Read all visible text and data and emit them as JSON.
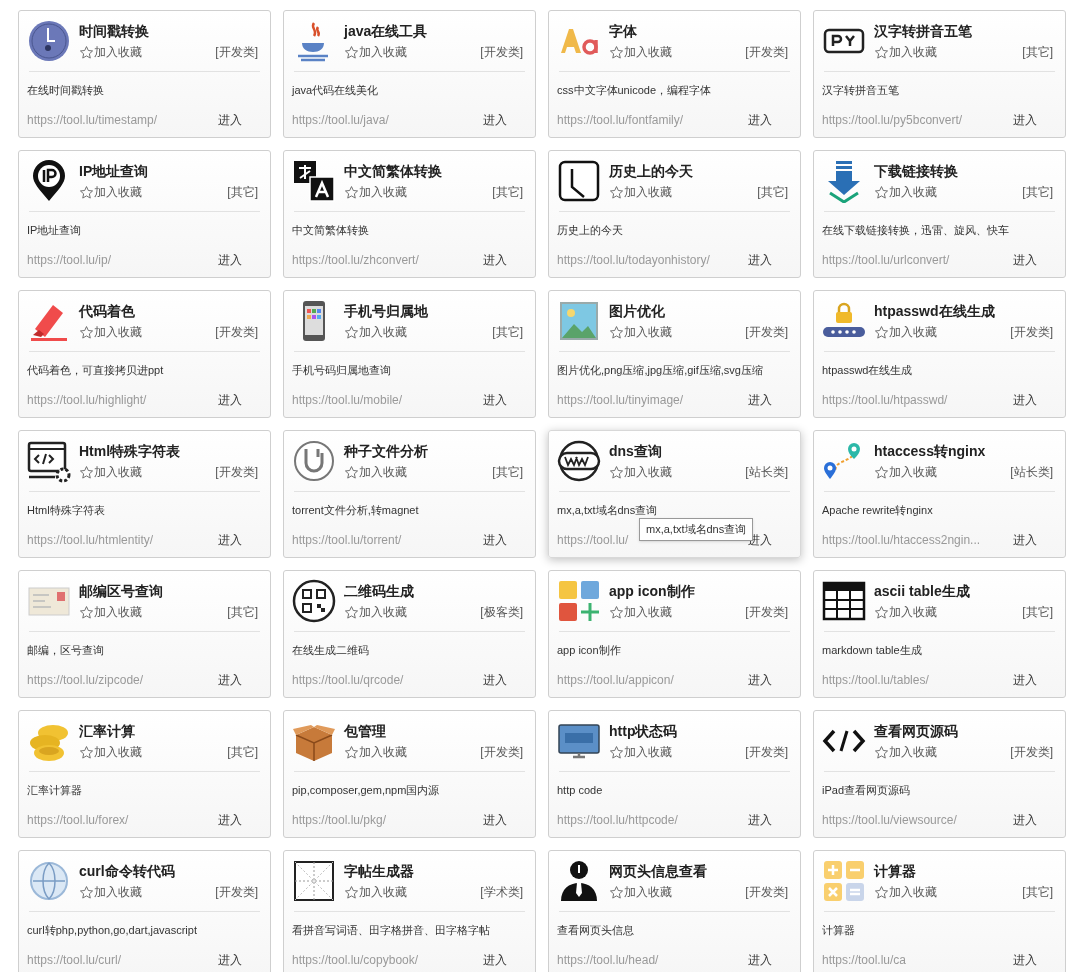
{
  "cards": [
    {
      "title": "时间戳转换",
      "favorite": "加入收藏",
      "category": "[开发类]",
      "description": "在线时间戳转换",
      "url": "https://tool.lu/timestamp/",
      "enter": "进入",
      "hovered": false
    },
    {
      "title": "java在线工具",
      "favorite": "加入收藏",
      "category": "[开发类]",
      "description": "java代码在线美化",
      "url": "https://tool.lu/java/",
      "enter": "进入",
      "hovered": false
    },
    {
      "title": "字体",
      "favorite": "加入收藏",
      "category": "[开发类]",
      "description": "css中文字体unicode，编程字体",
      "url": "https://tool.lu/fontfamily/",
      "enter": "进入",
      "hovered": false
    },
    {
      "title": "汉字转拼音五笔",
      "favorite": "加入收藏",
      "category": "[其它]",
      "description": "汉字转拼音五笔",
      "url": "https://tool.lu/py5bconvert/",
      "enter": "进入",
      "hovered": false
    },
    {
      "title": "IP地址查询",
      "favorite": "加入收藏",
      "category": "[其它]",
      "description": "IP地址查询",
      "url": "https://tool.lu/ip/",
      "enter": "进入",
      "hovered": false
    },
    {
      "title": "中文简繁体转换",
      "favorite": "加入收藏",
      "category": "[其它]",
      "description": "中文简繁体转换",
      "url": "https://tool.lu/zhconvert/",
      "enter": "进入",
      "hovered": false
    },
    {
      "title": "历史上的今天",
      "favorite": "加入收藏",
      "category": "[其它]",
      "description": "历史上的今天",
      "url": "https://tool.lu/todayonhistory/",
      "enter": "进入",
      "hovered": false
    },
    {
      "title": "下载链接转换",
      "favorite": "加入收藏",
      "category": "[其它]",
      "description": "在线下载链接转换，迅雷、旋风、快车",
      "url": "https://tool.lu/urlconvert/",
      "enter": "进入",
      "hovered": false
    },
    {
      "title": "代码着色",
      "favorite": "加入收藏",
      "category": "[开发类]",
      "description": "代码着色，可直接拷贝进ppt",
      "url": "https://tool.lu/highlight/",
      "enter": "进入",
      "hovered": false
    },
    {
      "title": "手机号归属地",
      "favorite": "加入收藏",
      "category": "[其它]",
      "description": "手机号码归属地查询",
      "url": "https://tool.lu/mobile/",
      "enter": "进入",
      "hovered": false
    },
    {
      "title": "图片优化",
      "favorite": "加入收藏",
      "category": "[开发类]",
      "description": "图片优化,png压缩,jpg压缩,gif压缩,svg压缩",
      "url": "https://tool.lu/tinyimage/",
      "enter": "进入",
      "hovered": false
    },
    {
      "title": "htpasswd在线生成",
      "favorite": "加入收藏",
      "category": "[开发类]",
      "description": "htpasswd在线生成",
      "url": "https://tool.lu/htpasswd/",
      "enter": "进入",
      "hovered": false
    },
    {
      "title": "Html特殊字符表",
      "favorite": "加入收藏",
      "category": "[开发类]",
      "description": "Html特殊字符表",
      "url": "https://tool.lu/htmlentity/",
      "enter": "进入",
      "hovered": false
    },
    {
      "title": "种子文件分析",
      "favorite": "加入收藏",
      "category": "[其它]",
      "description": "torrent文件分析,转magnet",
      "url": "https://tool.lu/torrent/",
      "enter": "进入",
      "hovered": false
    },
    {
      "title": "dns查询",
      "favorite": "加入收藏",
      "category": "[站长类]",
      "description": "mx,a,txt域名dns查询",
      "url": "https://tool.lu/",
      "enter": "进入",
      "hovered": true,
      "tooltip": "mx,a,txt域名dns查询"
    },
    {
      "title": "htaccess转nginx",
      "favorite": "加入收藏",
      "category": "[站长类]",
      "description": "Apache rewrite转nginx",
      "url": "https://tool.lu/htaccess2ngin...",
      "enter": "进入",
      "hovered": false
    },
    {
      "title": "邮编区号查询",
      "favorite": "加入收藏",
      "category": "[其它]",
      "description": "邮编，区号查询",
      "url": "https://tool.lu/zipcode/",
      "enter": "进入",
      "hovered": false
    },
    {
      "title": "二维码生成",
      "favorite": "加入收藏",
      "category": "[极客类]",
      "description": "在线生成二维码",
      "url": "https://tool.lu/qrcode/",
      "enter": "进入",
      "hovered": false
    },
    {
      "title": "app icon制作",
      "favorite": "加入收藏",
      "category": "[开发类]",
      "description": "app icon制作",
      "url": "https://tool.lu/appicon/",
      "enter": "进入",
      "hovered": false
    },
    {
      "title": "ascii table生成",
      "favorite": "加入收藏",
      "category": "[其它]",
      "description": "markdown table生成",
      "url": "https://tool.lu/tables/",
      "enter": "进入",
      "hovered": false
    },
    {
      "title": "汇率计算",
      "favorite": "加入收藏",
      "category": "[其它]",
      "description": "汇率计算器",
      "url": "https://tool.lu/forex/",
      "enter": "进入",
      "hovered": false
    },
    {
      "title": "包管理",
      "favorite": "加入收藏",
      "category": "[开发类]",
      "description": "pip,composer,gem,npm国内源",
      "url": "https://tool.lu/pkg/",
      "enter": "进入",
      "hovered": false
    },
    {
      "title": "http状态码",
      "favorite": "加入收藏",
      "category": "[开发类]",
      "description": "http code",
      "url": "https://tool.lu/httpcode/",
      "enter": "进入",
      "hovered": false
    },
    {
      "title": "查看网页源码",
      "favorite": "加入收藏",
      "category": "[开发类]",
      "description": "iPad查看网页源码",
      "url": "https://tool.lu/viewsource/",
      "enter": "进入",
      "hovered": false
    },
    {
      "title": "curl命令转代码",
      "favorite": "加入收藏",
      "category": "[开发类]",
      "description": "curl转php,python,go,dart,javascript",
      "url": "https://tool.lu/curl/",
      "enter": "进入",
      "hovered": false
    },
    {
      "title": "字帖生成器",
      "favorite": "加入收藏",
      "category": "[学术类]",
      "description": "看拼音写词语、田字格拼音、田字格字帖",
      "url": "https://tool.lu/copybook/",
      "enter": "进入",
      "hovered": false
    },
    {
      "title": "网页头信息查看",
      "favorite": "加入收藏",
      "category": "[开发类]",
      "description": "查看网页头信息",
      "url": "https://tool.lu/head/",
      "enter": "进入",
      "hovered": false
    },
    {
      "title": "计算器",
      "favorite": "加入收藏",
      "category": "[其它]",
      "description": "计算器",
      "url": "https://tool.lu/ca",
      "enter": "进入",
      "hovered": false
    }
  ]
}
